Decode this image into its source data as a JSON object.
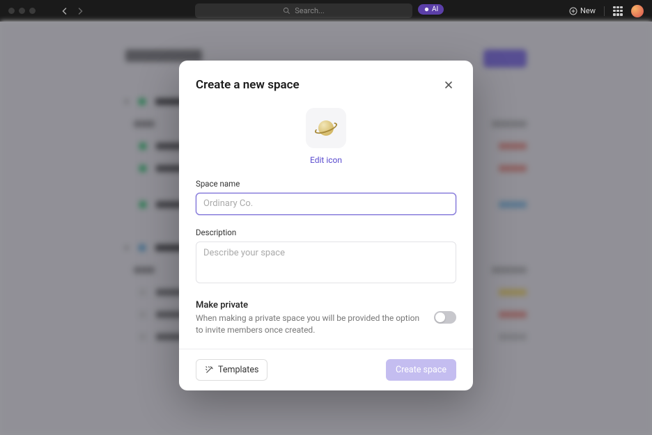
{
  "topbar": {
    "search_placeholder": "Search...",
    "ai_label": "AI",
    "new_label": "New"
  },
  "modal": {
    "title": "Create a new space",
    "edit_icon_label": "Edit icon",
    "space_name_label": "Space name",
    "space_name_placeholder": "Ordinary Co.",
    "description_label": "Description",
    "description_placeholder": "Describe your space",
    "private_title": "Make private",
    "private_desc": "When making a private space you will be provided the option to invite members once created.",
    "templates_label": "Templates",
    "create_label": "Create space"
  }
}
